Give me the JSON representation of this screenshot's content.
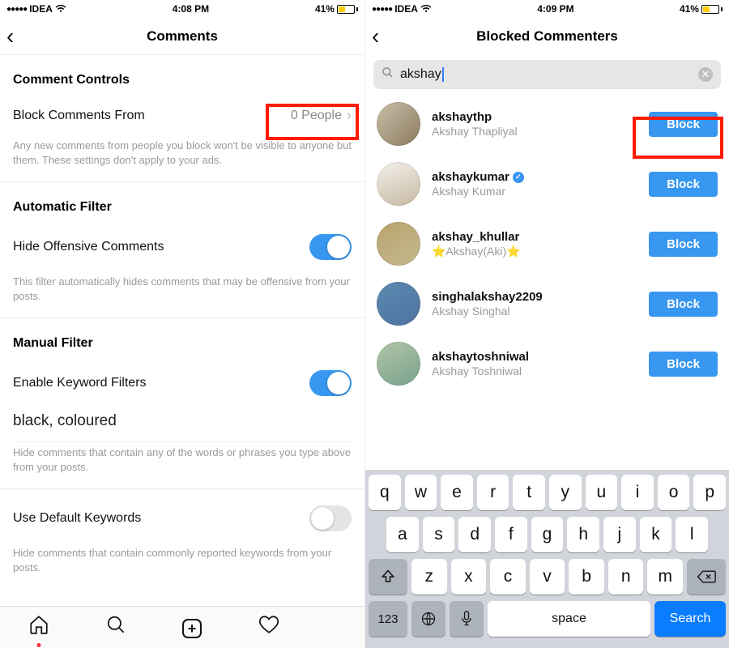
{
  "left": {
    "status": {
      "carrier": "IDEA",
      "time": "4:08 PM",
      "battery_pct": "41%"
    },
    "nav": {
      "title": "Comments"
    },
    "section1": {
      "head": "Comment Controls",
      "block_row_label": "Block Comments From",
      "block_row_value": "0 People",
      "desc": "Any new comments from people you block won't be visible to anyone but them. These settings don't apply to your ads."
    },
    "section2": {
      "head": "Automatic Filter",
      "toggle_label": "Hide Offensive Comments",
      "desc": "This filter automatically hides comments that may be offensive from your posts."
    },
    "section3": {
      "head": "Manual Filter",
      "toggle_label": "Enable Keyword Filters",
      "keywords": "black, coloured",
      "desc": "Hide comments that contain any of the words or phrases you type above from your posts."
    },
    "section4": {
      "row_label": "Use Default Keywords",
      "desc": "Hide comments that contain commonly reported keywords from your posts."
    }
  },
  "right": {
    "status": {
      "carrier": "IDEA",
      "time": "4:09 PM",
      "battery_pct": "41%"
    },
    "nav": {
      "title": "Blocked Commenters"
    },
    "search": {
      "query": "akshay"
    },
    "users": [
      {
        "username": "akshaythp",
        "display": "Akshay Thapliyal",
        "verified": false,
        "button": "Block"
      },
      {
        "username": "akshaykumar",
        "display": "Akshay Kumar",
        "verified": true,
        "button": "Block"
      },
      {
        "username": "akshay_khullar",
        "display": "⭐️Akshay(Aki)⭐️",
        "verified": false,
        "button": "Block"
      },
      {
        "username": "singhalakshay2209",
        "display": "Akshay Singhal",
        "verified": false,
        "button": "Block"
      },
      {
        "username": "akshaytoshniwal",
        "display": "Akshay Toshniwal",
        "verified": false,
        "button": "Block"
      }
    ],
    "keyboard": {
      "row1": [
        "q",
        "w",
        "e",
        "r",
        "t",
        "y",
        "u",
        "i",
        "o",
        "p"
      ],
      "row2": [
        "a",
        "s",
        "d",
        "f",
        "g",
        "h",
        "j",
        "k",
        "l"
      ],
      "row3": [
        "z",
        "x",
        "c",
        "v",
        "b",
        "n",
        "m"
      ],
      "num_key": "123",
      "space": "space",
      "search": "Search"
    }
  }
}
